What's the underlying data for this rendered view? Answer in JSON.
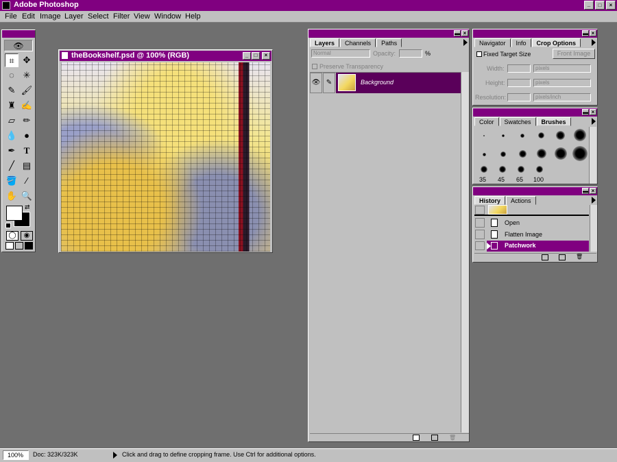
{
  "app": {
    "title": "Adobe Photoshop"
  },
  "menu": [
    "File",
    "Edit",
    "Image",
    "Layer",
    "Select",
    "Filter",
    "View",
    "Window",
    "Help"
  ],
  "document": {
    "title": "theBookshelf.psd @ 100% (RGB)"
  },
  "layers_panel": {
    "tabs": [
      "Layers",
      "Channels",
      "Paths"
    ],
    "active_tab": "Layers",
    "blend_mode": "Normal",
    "opacity_label": "Opacity:",
    "opacity_unit": "%",
    "preserve_label": "Preserve Transparency",
    "layer_name": "Background"
  },
  "crop_panel": {
    "tabs": [
      "Navigator",
      "Info",
      "Crop Options"
    ],
    "active_tab": "Crop Options",
    "fixed_size_label": "Fixed Target Size",
    "front_image_label": "Front Image",
    "width_label": "Width:",
    "height_label": "Height:",
    "resolution_label": "Resolution:",
    "width_unit": "pixels",
    "height_unit": "pixels",
    "resolution_unit": "pixels/inch"
  },
  "brushes_panel": {
    "tabs": [
      "Color",
      "Swatches",
      "Brushes"
    ],
    "active_tab": "Brushes",
    "size_labels": [
      "35",
      "45",
      "65",
      "100"
    ]
  },
  "history_panel": {
    "tabs": [
      "History",
      "Actions"
    ],
    "active_tab": "History",
    "items": [
      "Open",
      "Flatten Image",
      "Patchwork"
    ],
    "selected": "Patchwork"
  },
  "status_bar": {
    "zoom": "100%",
    "doc_size": "Doc: 323K/323K",
    "message": "Click and drag to define cropping frame. Use Ctrl for additional options."
  },
  "colors": {
    "title_bar": "#800080",
    "selected_layer": "#5a005a",
    "selected_history": "#800080",
    "desktop": "#6f6f6f",
    "panel": "#c0c0c0"
  }
}
